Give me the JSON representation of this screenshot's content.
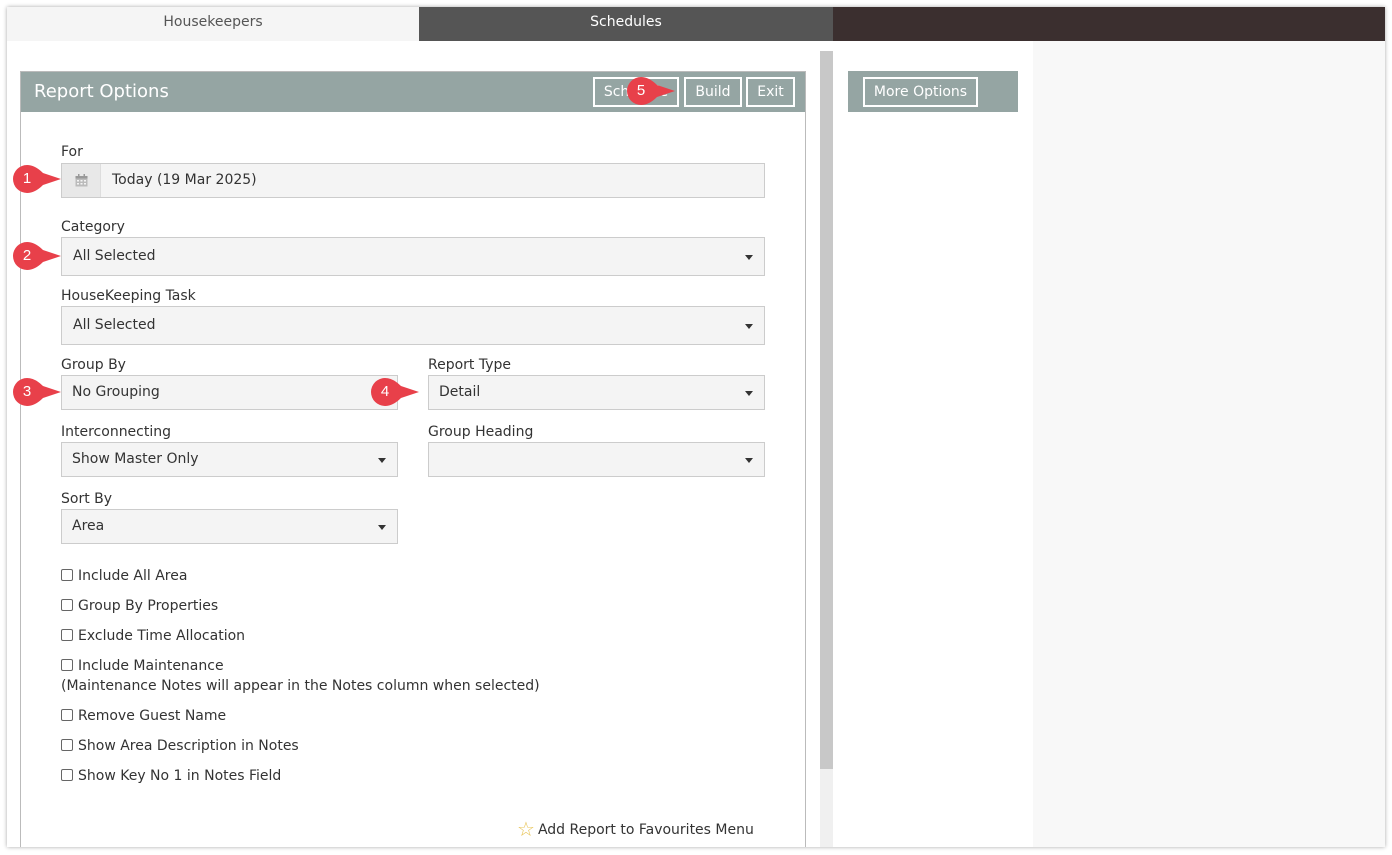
{
  "tabs": [
    {
      "label": "Housekeepers",
      "active": false
    },
    {
      "label": "Schedules",
      "active": true
    }
  ],
  "panel": {
    "title": "Report Options",
    "buttons": {
      "schedule": "Schedule",
      "build": "Build",
      "exit": "Exit"
    }
  },
  "fields": {
    "for": {
      "label": "For",
      "value": "Today (19 Mar 2025)"
    },
    "category": {
      "label": "Category",
      "value": "All Selected"
    },
    "task": {
      "label": "HouseKeeping Task",
      "value": "All Selected"
    },
    "group_by": {
      "label": "Group By",
      "value": "No Grouping"
    },
    "report_type": {
      "label": "Report Type",
      "value": "Detail"
    },
    "interconnecting": {
      "label": "Interconnecting",
      "value": "Show Master Only"
    },
    "group_heading": {
      "label": "Group Heading",
      "value": ""
    },
    "sort_by": {
      "label": "Sort By",
      "value": "Area"
    }
  },
  "checkboxes": [
    {
      "label": "Include All Area",
      "checked": false
    },
    {
      "label": "Group By Properties",
      "checked": false
    },
    {
      "label": "Exclude Time Allocation",
      "checked": false
    },
    {
      "label": "Include Maintenance",
      "checked": false
    },
    {
      "label": "Remove Guest Name",
      "checked": false
    },
    {
      "label": "Show Area Description in Notes",
      "checked": false
    },
    {
      "label": "Show Key No 1 in Notes Field",
      "checked": false
    }
  ],
  "maintenance_note": "(Maintenance Notes will appear in the Notes column when selected)",
  "favourites_label": "Add Report to Favourites Menu",
  "more_options_label": "More Options",
  "markers": [
    "1",
    "2",
    "3",
    "4",
    "5"
  ],
  "colors": {
    "header": "#95a5a3",
    "tab_active": "#555555",
    "tab_bar": "#3b2f2f",
    "marker": "#e8404a"
  },
  "icons": {
    "calendar": "calendar-icon",
    "star": "star-icon",
    "caret": "caret-down-icon"
  }
}
